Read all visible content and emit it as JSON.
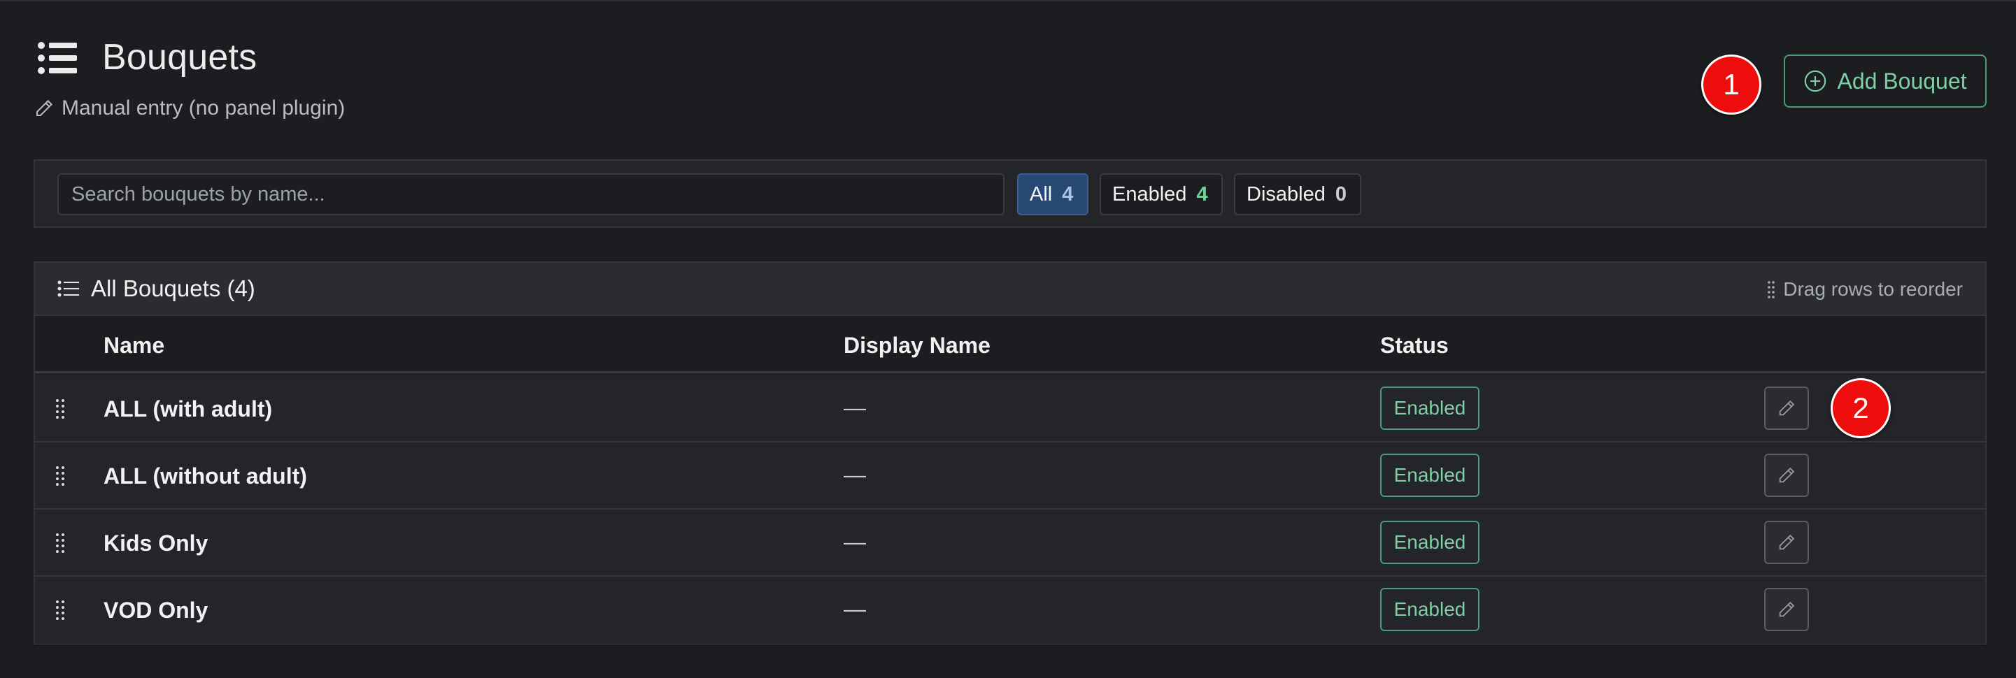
{
  "header": {
    "title": "Bouquets",
    "title_icon": "list-icon",
    "subtitle": "Manual entry (no panel plugin)",
    "subtitle_icon": "pencil-icon",
    "add_button_label": "Add Bouquet",
    "add_button_icon": "plus-circle-icon"
  },
  "markers": {
    "one": "1",
    "two": "2"
  },
  "filters": {
    "search_placeholder": "Search bouquets by name...",
    "search_value": "",
    "pills": [
      {
        "label": "All",
        "count": "4",
        "active": true
      },
      {
        "label": "Enabled",
        "count": "4",
        "active": false
      },
      {
        "label": "Disabled",
        "count": "0",
        "active": false
      }
    ]
  },
  "table": {
    "title": "All Bouquets (4)",
    "title_icon": "list-icon",
    "drag_hint": "Drag rows to reorder",
    "drag_hint_icon": "grip-icon",
    "columns": [
      "Name",
      "Display Name",
      "Status"
    ],
    "rows": [
      {
        "name": "ALL (with adult)",
        "display_name": "—",
        "status": "Enabled"
      },
      {
        "name": "ALL (without adult)",
        "display_name": "—",
        "status": "Enabled"
      },
      {
        "name": "Kids Only",
        "display_name": "—",
        "status": "Enabled"
      },
      {
        "name": "VOD Only",
        "display_name": "—",
        "status": "Enabled"
      }
    ],
    "row_action_icon": "pencil-icon"
  },
  "colors": {
    "background": "#1c1d20",
    "accent_green": "#7fcfa4",
    "active_pill": "#284874",
    "marker_red": "#ee0d0d"
  }
}
